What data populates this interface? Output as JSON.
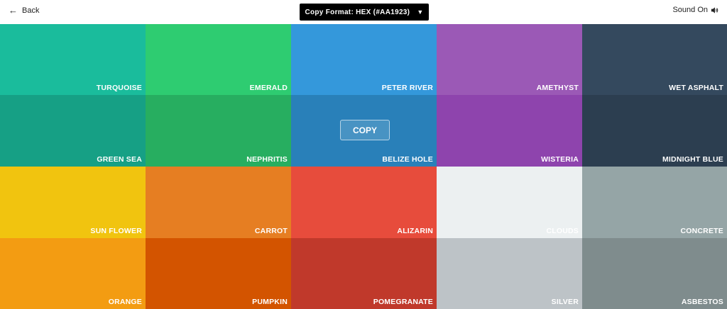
{
  "header": {
    "back_label": "Back",
    "copy_format_label": "Copy Format: HEX (#AA1923)",
    "sound_label": "Sound On"
  },
  "swatches": [
    {
      "name": "TURQUOISE",
      "color": "#1abc9c"
    },
    {
      "name": "EMERALD",
      "color": "#2ecc71"
    },
    {
      "name": "PETER RIVER",
      "color": "#3498db"
    },
    {
      "name": "AMETHYST",
      "color": "#9b59b6"
    },
    {
      "name": "WET ASPHALT",
      "color": "#34495e"
    },
    {
      "name": "GREEN SEA",
      "color": "#16a085"
    },
    {
      "name": "NEPHRITIS",
      "color": "#27ae60"
    },
    {
      "name": "BELIZE HOLE",
      "color": "#2980b9",
      "copy_label": "COPY"
    },
    {
      "name": "WISTERIA",
      "color": "#8e44ad"
    },
    {
      "name": "MIDNIGHT BLUE",
      "color": "#2c3e50"
    },
    {
      "name": "SUN FLOWER",
      "color": "#f1c40f"
    },
    {
      "name": "CARROT",
      "color": "#e67e22"
    },
    {
      "name": "ALIZARIN",
      "color": "#e74c3c"
    },
    {
      "name": "CLOUDS",
      "color": "#ecf0f1"
    },
    {
      "name": "CONCRETE",
      "color": "#95a5a6"
    },
    {
      "name": "ORANGE",
      "color": "#f39c12"
    },
    {
      "name": "PUMPKIN",
      "color": "#d35400"
    },
    {
      "name": "POMEGRANATE",
      "color": "#c0392b"
    },
    {
      "name": "SILVER",
      "color": "#bdc3c7"
    },
    {
      "name": "ASBESTOS",
      "color": "#7f8c8d"
    }
  ]
}
